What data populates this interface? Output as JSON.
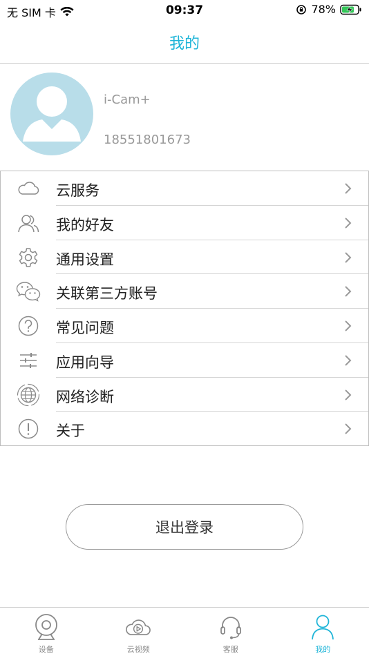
{
  "status_bar": {
    "carrier": "无 SIM 卡",
    "time": "09:37",
    "battery": "78%"
  },
  "nav": {
    "title": "我的"
  },
  "profile": {
    "username": "i-Cam+",
    "phone": "18551801673"
  },
  "menu": {
    "items": [
      {
        "label": "云服务",
        "icon": "cloud-icon"
      },
      {
        "label": "我的好友",
        "icon": "friends-icon"
      },
      {
        "label": "通用设置",
        "icon": "gear-icon"
      },
      {
        "label": "关联第三方账号",
        "icon": "wechat-icon"
      },
      {
        "label": "常见问题",
        "icon": "question-icon"
      },
      {
        "label": "应用向导",
        "icon": "sliders-icon"
      },
      {
        "label": "网络诊断",
        "icon": "globe-icon"
      },
      {
        "label": "关于",
        "icon": "info-icon"
      }
    ]
  },
  "logout_label": "退出登录",
  "tabs": [
    {
      "label": "设备",
      "icon": "camera-icon",
      "active": false
    },
    {
      "label": "云视频",
      "icon": "cloud-play-icon",
      "active": false
    },
    {
      "label": "客服",
      "icon": "headset-icon",
      "active": false
    },
    {
      "label": "我的",
      "icon": "person-icon",
      "active": true
    }
  ],
  "colors": {
    "accent": "#1fb5d8",
    "avatar_bg": "#b8dde9",
    "icon_gray": "#8a8a8a"
  }
}
